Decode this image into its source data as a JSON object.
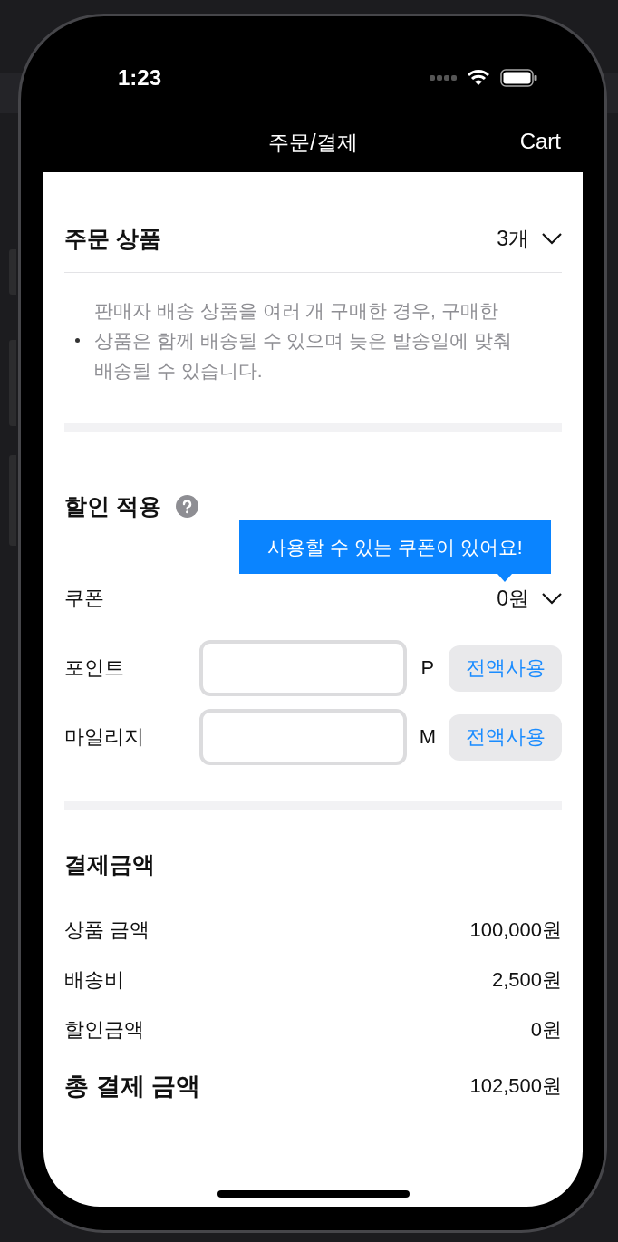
{
  "status_bar": {
    "time": "1:23"
  },
  "nav": {
    "title": "주문/결제",
    "right_button": "Cart"
  },
  "order_items": {
    "title": "주문 상품",
    "count": "3개",
    "expanded": false,
    "notices": [
      "판매자 배송 상품을 여러 개 구매한 경우, 구매한 상품은 함께 배송될 수 있으며 늦은 발송일에 맞춰 배송될 수 있습니다."
    ]
  },
  "discount": {
    "title": "할인 적용",
    "tooltip": "사용할 수 있는 쿠폰이 있어요!",
    "coupon": {
      "label": "쿠폰",
      "value": "0원",
      "expanded": false
    },
    "inputs": [
      {
        "label": "포인트",
        "unit": "P",
        "button": "전액사용"
      },
      {
        "label": "마일리지",
        "unit": "M",
        "button": "전액사용"
      }
    ]
  },
  "payment": {
    "title": "결제금액",
    "rows": [
      {
        "kind": "item",
        "label": "상품 금액",
        "value": "100,000원"
      },
      {
        "kind": "item",
        "label": "배송비",
        "value": "2,500원"
      },
      {
        "kind": "item",
        "label": "할인금액",
        "value": "0원"
      },
      {
        "kind": "total",
        "label": "총 결제 금액",
        "value": "102,500원"
      }
    ]
  }
}
